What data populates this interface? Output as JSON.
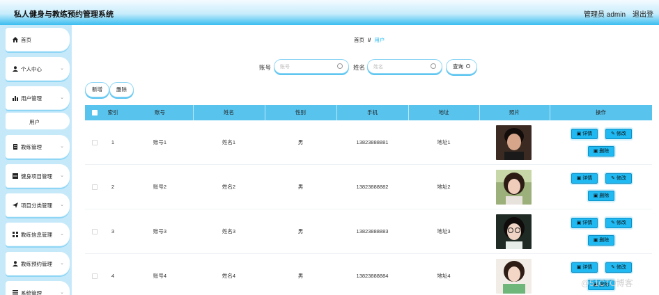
{
  "header": {
    "app_title": "私人健身与教练预约管理系统",
    "admin_label": "管理员 admin",
    "logout_label": "退出登"
  },
  "sidebar": {
    "items": [
      {
        "label": "首页",
        "icon": "home-icon"
      },
      {
        "label": "个人中心",
        "icon": "user-icon"
      },
      {
        "label": "用户管理",
        "icon": "bar-chart-icon"
      },
      {
        "label": "用户",
        "icon": ""
      },
      {
        "label": "教练管理",
        "icon": "document-icon"
      },
      {
        "label": "健身项目管理",
        "icon": "grid-icon"
      },
      {
        "label": "项目分类管理",
        "icon": "send-icon"
      },
      {
        "label": "教练信息管理",
        "icon": "apps-icon"
      },
      {
        "label": "教练预约管理",
        "icon": "user-icon"
      },
      {
        "label": "系统管理",
        "icon": "list-icon"
      }
    ]
  },
  "breadcrumb": {
    "home": "首页",
    "separator": "//",
    "current": "用户"
  },
  "search": {
    "account_label": "账号",
    "account_placeholder": "账号",
    "name_label": "姓名",
    "name_placeholder": "姓名",
    "query_button": "查询"
  },
  "toolbar": {
    "add_label": "新增",
    "delete_label": "删除"
  },
  "table": {
    "headers": [
      "索引",
      "账号",
      "姓名",
      "性别",
      "手机",
      "地址",
      "照片",
      "操作"
    ],
    "rows": [
      {
        "index": "1",
        "account": "账号1",
        "name": "姓名1",
        "gender": "男",
        "phone": "13823888881",
        "address": "地址1"
      },
      {
        "index": "2",
        "account": "账号2",
        "name": "姓名2",
        "gender": "男",
        "phone": "13823888882",
        "address": "地址2"
      },
      {
        "index": "3",
        "account": "账号3",
        "name": "姓名3",
        "gender": "男",
        "phone": "13823888883",
        "address": "地址3"
      },
      {
        "index": "4",
        "account": "账号4",
        "name": "姓名4",
        "gender": "男",
        "phone": "13823888884",
        "address": "地址4"
      }
    ],
    "actions": {
      "detail": "详情",
      "edit": "修改",
      "delete": "删除"
    }
  },
  "watermark": "@51CTO博客",
  "colors": {
    "accent": "#20b9f2",
    "table_header": "#58c4ee",
    "sidebar_bg": "#c6e9fa"
  }
}
